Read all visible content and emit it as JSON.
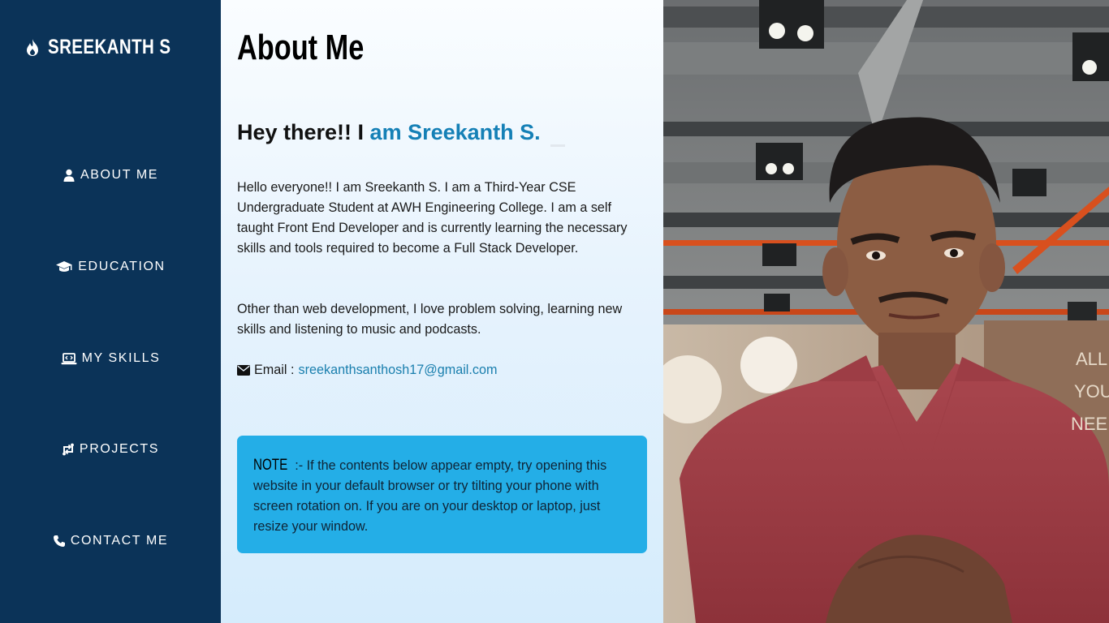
{
  "brand": {
    "name": "SREEKANTH S",
    "icon": "fire-icon"
  },
  "nav": {
    "items": [
      {
        "label": "ABOUT ME",
        "icon": "user-icon"
      },
      {
        "label": "EDUCATION",
        "icon": "graduation-cap-icon"
      },
      {
        "label": "MY SKILLS",
        "icon": "laptop-code-icon"
      },
      {
        "label": "PROJECTS",
        "icon": "project-diagram-icon"
      },
      {
        "label": "CONTACT ME",
        "icon": "phone-icon"
      }
    ]
  },
  "main": {
    "title": "About Me",
    "greeting_prefix": "Hey there!! I",
    "greeting_typed": " am Sreekanth S.",
    "paragraph1": "Hello everyone!! I am Sreekanth S. I am a Third-Year CSE Undergraduate Student at AWH Engineering College. I am a self taught Front End Developer and is currently learning the necessary skills and tools required to become a Full Stack Developer.",
    "paragraph2": "Other than web development, I love problem solving, learning new skills and listening to music and podcasts.",
    "email_label": "Email :",
    "email": "sreekanthsanthosh17@gmail.com",
    "note_label": "NOTE",
    "note_text": " :- If the contents below appear empty, try opening this website in your default browser or try tilting your phone with screen rotation on. If you are on your desktop or laptop, just resize your window."
  },
  "photo": {
    "wall_text": [
      "ALL",
      "YOU",
      "NEED"
    ]
  },
  "colors": {
    "sidebar_bg": "#0b3358",
    "accent": "#1580b6",
    "note_bg": "#24aee7",
    "link": "#1a7fae"
  }
}
